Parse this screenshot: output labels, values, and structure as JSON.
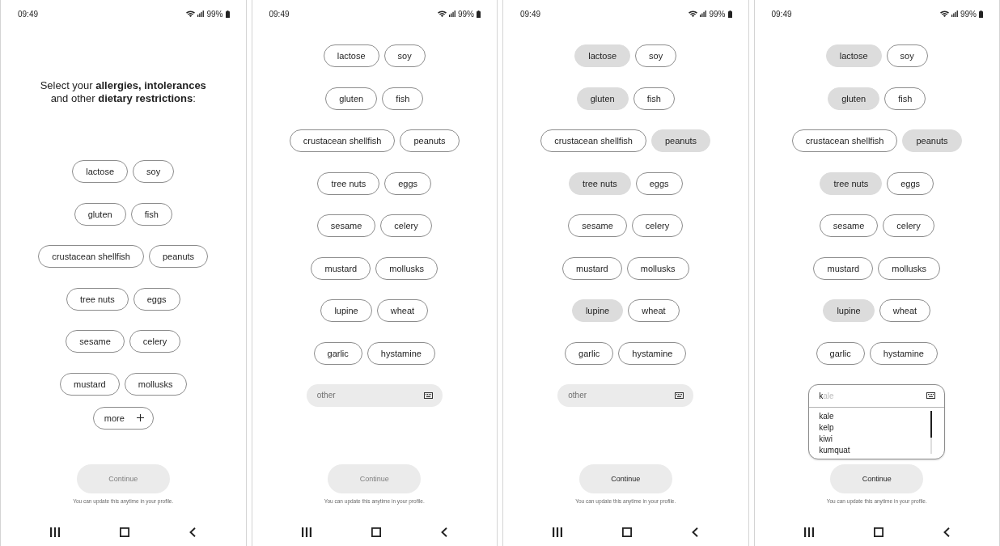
{
  "screens": [
    {
      "status_bar": {
        "time": "09:49",
        "battery": "99%"
      },
      "heading": "Select your **allergies, intolerances** and other **dietary restrictions**:",
      "option_rows": [
        [
          {
            "label": "lactose",
            "selected": false
          },
          {
            "label": "soy",
            "selected": false
          }
        ],
        [
          {
            "label": "gluten",
            "selected": false
          },
          {
            "label": "fish",
            "selected": false
          }
        ],
        [
          {
            "label": "crustacean shellfish",
            "selected": false
          },
          {
            "label": "peanuts",
            "selected": false
          }
        ],
        [
          {
            "label": "tree nuts",
            "selected": false
          },
          {
            "label": "eggs",
            "selected": false
          }
        ],
        [
          {
            "label": "sesame",
            "selected": false
          },
          {
            "label": "celery",
            "selected": false
          }
        ],
        [
          {
            "label": "mustard",
            "selected": false
          },
          {
            "label": "mollusks",
            "selected": false
          }
        ]
      ],
      "more_button": {
        "label": "more"
      },
      "continue_button": {
        "label": "Continue",
        "disabled": true
      },
      "note": "You can update this anytime in your profile."
    },
    {
      "status_bar": {
        "time": "09:49",
        "battery": "99%"
      },
      "option_rows": [
        [
          {
            "label": "lactose",
            "selected": false
          },
          {
            "label": "soy",
            "selected": false
          }
        ],
        [
          {
            "label": "gluten",
            "selected": false
          },
          {
            "label": "fish",
            "selected": false
          }
        ],
        [
          {
            "label": "crustacean shellfish",
            "selected": false
          },
          {
            "label": "peanuts",
            "selected": false
          }
        ],
        [
          {
            "label": "tree nuts",
            "selected": false
          },
          {
            "label": "eggs",
            "selected": false
          }
        ],
        [
          {
            "label": "sesame",
            "selected": false
          },
          {
            "label": "celery",
            "selected": false
          }
        ],
        [
          {
            "label": "mustard",
            "selected": false
          },
          {
            "label": "mollusks",
            "selected": false
          }
        ],
        [
          {
            "label": "lupine",
            "selected": false
          },
          {
            "label": "wheat",
            "selected": false
          }
        ],
        [
          {
            "label": "garlic",
            "selected": false
          },
          {
            "label": "hystamine",
            "selected": false
          }
        ]
      ],
      "other_field": {
        "placeholder": "other",
        "expanded": false
      },
      "continue_button": {
        "label": "Continue",
        "disabled": true
      },
      "note": "You can update this anytime in your profile."
    },
    {
      "status_bar": {
        "time": "09:49",
        "battery": "99%"
      },
      "option_rows": [
        [
          {
            "label": "lactose",
            "selected": true
          },
          {
            "label": "soy",
            "selected": false
          }
        ],
        [
          {
            "label": "gluten",
            "selected": true
          },
          {
            "label": "fish",
            "selected": false
          }
        ],
        [
          {
            "label": "crustacean shellfish",
            "selected": false
          },
          {
            "label": "peanuts",
            "selected": true
          }
        ],
        [
          {
            "label": "tree nuts",
            "selected": true
          },
          {
            "label": "eggs",
            "selected": false
          }
        ],
        [
          {
            "label": "sesame",
            "selected": false
          },
          {
            "label": "celery",
            "selected": false
          }
        ],
        [
          {
            "label": "mustard",
            "selected": false
          },
          {
            "label": "mollusks",
            "selected": false
          }
        ],
        [
          {
            "label": "lupine",
            "selected": true
          },
          {
            "label": "wheat",
            "selected": false
          }
        ],
        [
          {
            "label": "garlic",
            "selected": false
          },
          {
            "label": "hystamine",
            "selected": false
          }
        ]
      ],
      "other_field": {
        "placeholder": "other",
        "expanded": false
      },
      "continue_button": {
        "label": "Continue",
        "disabled": false
      },
      "note": "You can update this anytime in your profile."
    },
    {
      "status_bar": {
        "time": "09:49",
        "battery": "99%"
      },
      "option_rows": [
        [
          {
            "label": "lactose",
            "selected": true
          },
          {
            "label": "soy",
            "selected": false
          }
        ],
        [
          {
            "label": "gluten",
            "selected": true
          },
          {
            "label": "fish",
            "selected": false
          }
        ],
        [
          {
            "label": "crustacean shellfish",
            "selected": false
          },
          {
            "label": "peanuts",
            "selected": true
          }
        ],
        [
          {
            "label": "tree nuts",
            "selected": true
          },
          {
            "label": "eggs",
            "selected": false
          }
        ],
        [
          {
            "label": "sesame",
            "selected": false
          },
          {
            "label": "celery",
            "selected": false
          }
        ],
        [
          {
            "label": "mustard",
            "selected": false
          },
          {
            "label": "mollusks",
            "selected": false
          }
        ],
        [
          {
            "label": "lupine",
            "selected": true
          },
          {
            "label": "wheat",
            "selected": false
          }
        ],
        [
          {
            "label": "garlic",
            "selected": false
          },
          {
            "label": "hystamine",
            "selected": false
          }
        ]
      ],
      "other_field": {
        "value": "k",
        "completion": "ale",
        "expanded": true,
        "suggestions": [
          "kale",
          "kelp",
          "kiwi",
          "kumquat"
        ]
      },
      "continue_button": {
        "label": "Continue",
        "disabled": false
      },
      "note": "You can update this anytime in your profile."
    }
  ]
}
